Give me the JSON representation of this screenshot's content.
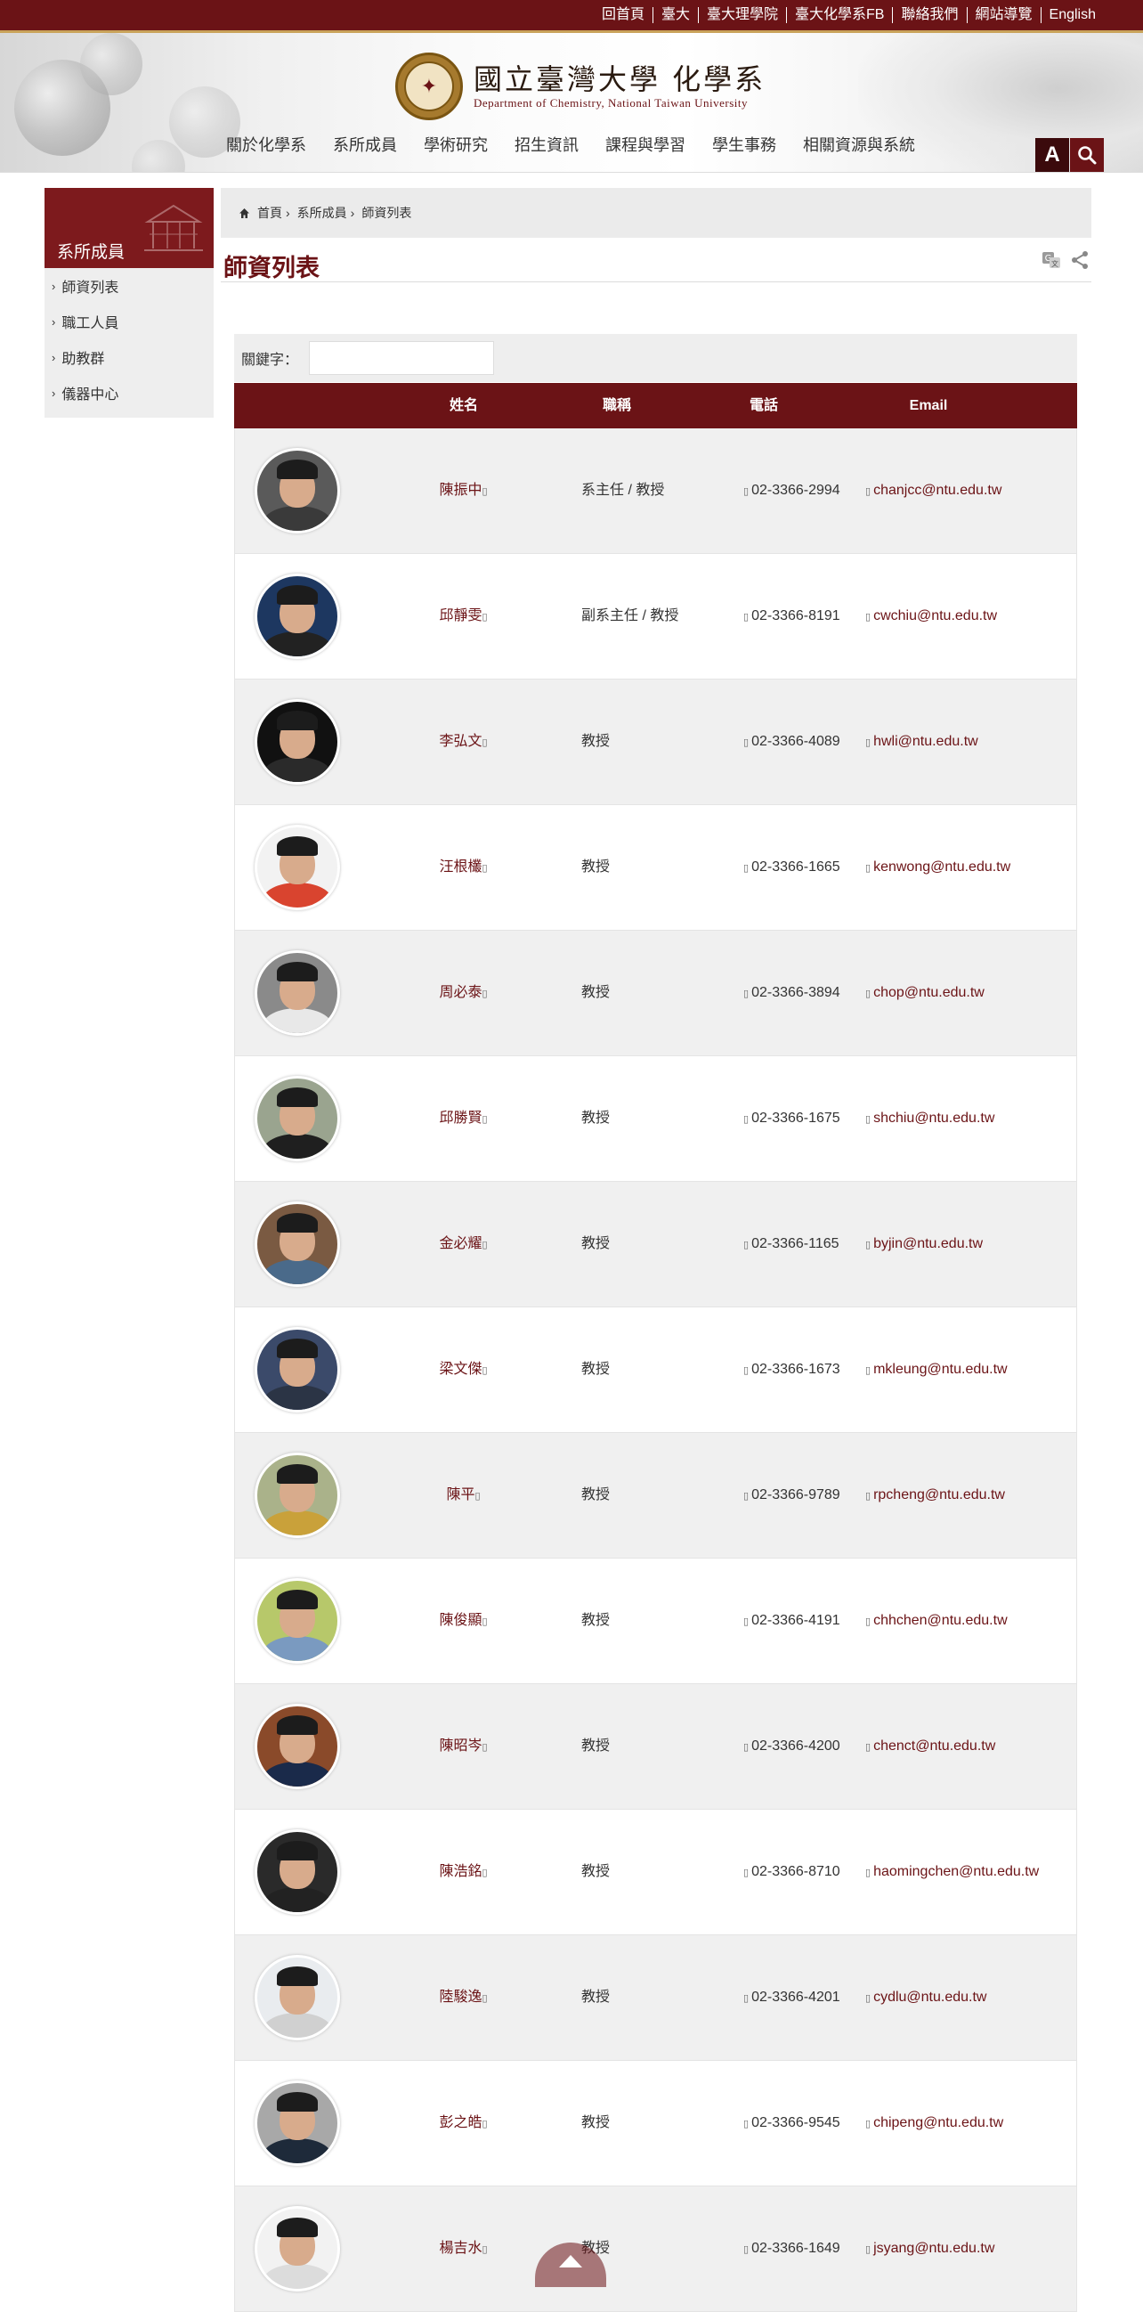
{
  "top_links": [
    "回首頁",
    "臺大",
    "臺大理學院",
    "臺大化學系FB",
    "聯絡我們",
    "網站導覽",
    "English"
  ],
  "logo": {
    "chinese": "國立臺灣大學 化學系",
    "english": "Department of Chemistry, National Taiwan University"
  },
  "main_nav": [
    "關於化學系",
    "系所成員",
    "學術研究",
    "招生資訊",
    "課程與學習",
    "學生事務",
    "相關資源與系統"
  ],
  "tools": {
    "font_size_label": "A"
  },
  "sidebar": {
    "title": "系所成員",
    "items": [
      "師資列表",
      "職工人員",
      "助教群",
      "儀器中心"
    ]
  },
  "breadcrumb": [
    "首頁",
    "系所成員",
    "師資列表"
  ],
  "page_title": "師資列表",
  "search": {
    "label": "關鍵字：",
    "value": "",
    "placeholder": ""
  },
  "table": {
    "headers": [
      "姓名",
      "職稱",
      "電話",
      "Email"
    ],
    "rows": [
      {
        "name": "陳振中",
        "title": "系主任 / 教授",
        "phone": "02-3366-2994",
        "email": "chanjcc@ntu.edu.tw"
      },
      {
        "name": "邱靜雯",
        "title": "副系主任 / 教授",
        "phone": "02-3366-8191",
        "email": "cwchiu@ntu.edu.tw"
      },
      {
        "name": "李弘文",
        "title": "教授",
        "phone": "02-3366-4089",
        "email": "hwli@ntu.edu.tw"
      },
      {
        "name": "汪根欉",
        "title": "教授",
        "phone": "02-3366-1665",
        "email": "kenwong@ntu.edu.tw"
      },
      {
        "name": "周必泰",
        "title": "教授",
        "phone": "02-3366-3894",
        "email": "chop@ntu.edu.tw"
      },
      {
        "name": "邱勝賢",
        "title": "教授",
        "phone": "02-3366-1675",
        "email": "shchiu@ntu.edu.tw"
      },
      {
        "name": "金必耀",
        "title": "教授",
        "phone": "02-3366-1165",
        "email": "byjin@ntu.edu.tw"
      },
      {
        "name": "梁文傑",
        "title": "教授",
        "phone": "02-3366-1673",
        "email": "mkleung@ntu.edu.tw"
      },
      {
        "name": "陳平",
        "title": "教授",
        "phone": "02-3366-9789",
        "email": "rpcheng@ntu.edu.tw"
      },
      {
        "name": "陳俊顯",
        "title": "教授",
        "phone": "02-3366-4191",
        "email": "chhchen@ntu.edu.tw"
      },
      {
        "name": "陳昭岑",
        "title": "教授",
        "phone": "02-3366-4200",
        "email": "chenct@ntu.edu.tw"
      },
      {
        "name": "陳浩銘",
        "title": "教授",
        "phone": "02-3366-8710",
        "email": "haomingchen@ntu.edu.tw"
      },
      {
        "name": "陸駿逸",
        "title": "教授",
        "phone": "02-3366-4201",
        "email": "cydlu@ntu.edu.tw"
      },
      {
        "name": "彭之皓",
        "title": "教授",
        "phone": "02-3366-9545",
        "email": "chipeng@ntu.edu.tw"
      },
      {
        "name": "楊吉水",
        "title": "教授",
        "phone": "02-3366-1649",
        "email": "jsyang@ntu.edu.tw"
      }
    ]
  },
  "colors": {
    "brand": "#6b1316",
    "brand_dark": "#3b0a0c",
    "gold": "#c9a35a",
    "row_alt": "#f0f0f0",
    "photo_backgrounds": [
      "#5a5a5a",
      "#1d3760",
      "#111111",
      "#f2f2f2",
      "#8a8a8a",
      "#9aa48f",
      "#7a5a42",
      "#3b4a6a",
      "#aab28a",
      "#b7c86a",
      "#8a4a2a",
      "#2a2a2a",
      "#e9ecef",
      "#a8a8a8",
      "#f2f2f2"
    ],
    "shirt_colors": [
      "#3a3a3a",
      "#222222",
      "#2a2a2a",
      "#d9442f",
      "#e8e8e8",
      "#1f1f1f",
      "#4a6a8a",
      "#2b3445",
      "#c9a13a",
      "#7a9ac0",
      "#1a2a4a",
      "#222222",
      "#d0d0d0",
      "#1e2a3a",
      "#dcdcdc"
    ]
  },
  "icons": [
    "home-icon",
    "translate-icon",
    "share-icon",
    "search-icon",
    "phone-icon",
    "mail-icon",
    "back-to-top-icon"
  ]
}
